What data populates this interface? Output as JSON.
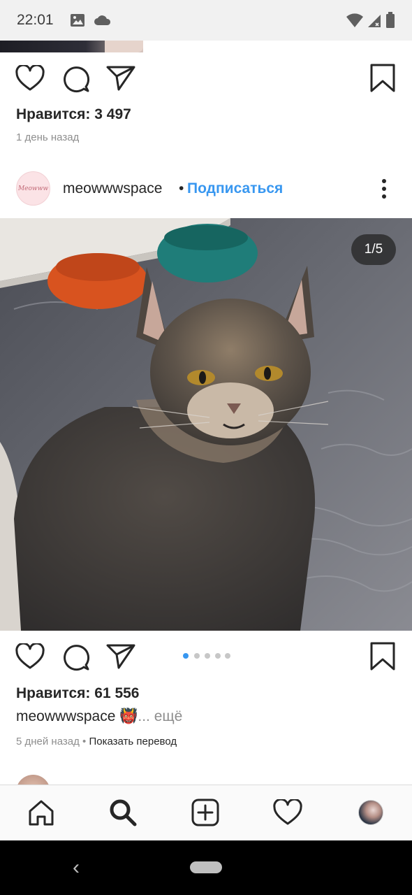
{
  "status_bar": {
    "time": "22:01",
    "icons": [
      "image-icon",
      "cloud-icon",
      "wifi-icon",
      "signal-icon",
      "battery-icon"
    ]
  },
  "previous_post": {
    "likes_text": "Нравится: 3 497",
    "time_ago": "1 день назад"
  },
  "post": {
    "username": "meowwwspace",
    "separator": "•",
    "follow_label": "Подписаться",
    "avatar_text": "Meowww",
    "photo_counter": "1/5",
    "carousel": {
      "total": 5,
      "active_index": 0
    },
    "likes_text": "Нравится: 61 556",
    "caption_username": "meowwwspace",
    "caption_emoji": "👹",
    "caption_more": "... ещё",
    "time_ago": "5 дней назад",
    "meta_separator": " • ",
    "translate_label": "Показать перевод"
  },
  "actions": [
    "heart-icon",
    "comment-icon",
    "share-icon",
    "bookmark-icon"
  ],
  "tab_bar": {
    "tabs": [
      "home",
      "search",
      "new-post",
      "activity",
      "profile"
    ],
    "active": "search"
  },
  "nav_bar": {
    "back_glyph": "‹"
  },
  "colors": {
    "accent": "#3897f0",
    "text": "#262626",
    "muted": "#8e8e8e",
    "status_bar_bg": "#f1f1f1",
    "nav_bar_bg": "#000000"
  }
}
